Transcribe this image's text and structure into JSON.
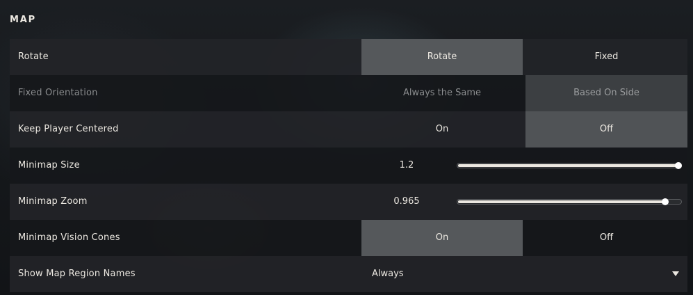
{
  "section": {
    "title": "MAP"
  },
  "rows": {
    "rotate": {
      "label": "Rotate",
      "options": [
        "Rotate",
        "Fixed"
      ],
      "selected": "Rotate"
    },
    "fixed_orientation": {
      "label": "Fixed Orientation",
      "options": [
        "Always the Same",
        "Based On Side"
      ],
      "selected": "Based On Side",
      "disabled": true
    },
    "keep_player_centered": {
      "label": "Keep Player Centered",
      "options": [
        "On",
        "Off"
      ],
      "selected": "Off"
    },
    "minimap_size": {
      "label": "Minimap Size",
      "value": "1.2",
      "fraction": 1.0
    },
    "minimap_zoom": {
      "label": "Minimap Zoom",
      "value": "0.965",
      "fraction": 0.93
    },
    "minimap_vision_cones": {
      "label": "Minimap Vision Cones",
      "options": [
        "On",
        "Off"
      ],
      "selected": "On"
    },
    "show_map_region_names": {
      "label": "Show Map Region Names",
      "value": "Always"
    }
  },
  "colors": {
    "text": "#ece8e1",
    "selected_bg": "#55585b",
    "disabled_text": "#8a8c8e"
  }
}
